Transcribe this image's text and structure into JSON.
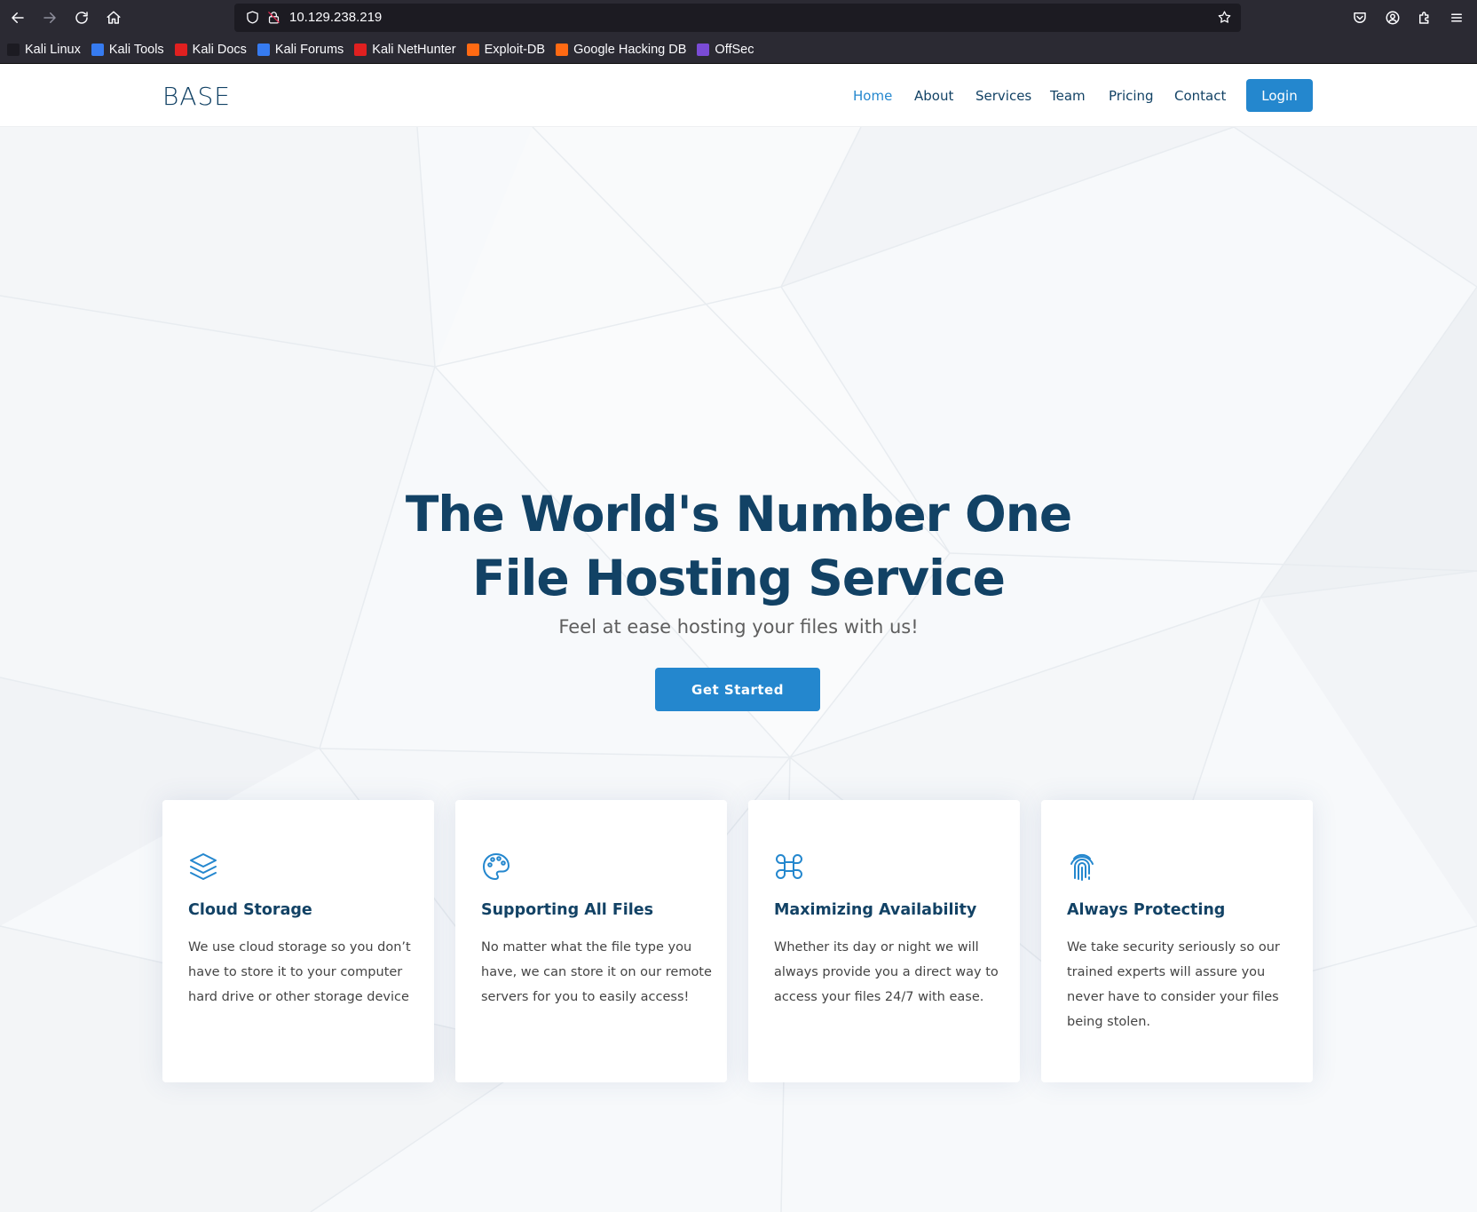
{
  "browser": {
    "url": "10.129.238.219",
    "bookmarks": [
      {
        "label": "Kali Linux",
        "color": "#1c1b22"
      },
      {
        "label": "Kali Tools",
        "color": "#367bf0"
      },
      {
        "label": "Kali Docs",
        "color": "#e02020"
      },
      {
        "label": "Kali Forums",
        "color": "#367bf0"
      },
      {
        "label": "Kali NetHunter",
        "color": "#e02020"
      },
      {
        "label": "Exploit-DB",
        "color": "#ff6a13"
      },
      {
        "label": "Google Hacking DB",
        "color": "#ff6a13"
      },
      {
        "label": "OffSec",
        "color": "#7a4bd6"
      }
    ]
  },
  "site": {
    "logo": "BASE",
    "nav": {
      "home": "Home",
      "about": "About",
      "services": "Services",
      "team": "Team",
      "pricing": "Pricing",
      "contact": "Contact",
      "login": "Login"
    },
    "hero": {
      "title_line1": "The World's Number One",
      "title_line2": "File Hosting Service",
      "subtitle": "Feel at ease hosting your files with us!",
      "cta": "Get Started"
    },
    "features": [
      {
        "icon": "layers-icon",
        "title": "Cloud Storage",
        "desc": "We use cloud storage so you don’t have to store it to your computer hard drive or other storage device"
      },
      {
        "icon": "palette-icon",
        "title": "Supporting All Files",
        "desc": "No matter what the file type you have, we can store it on our remote servers for you to easily access!"
      },
      {
        "icon": "command-icon",
        "title": "Maximizing Availability",
        "desc": "Whether its day or night we will always provide you a direct way to access your files 24/7 with ease."
      },
      {
        "icon": "fingerprint-icon",
        "title": "Always Protecting",
        "desc": "We take security seriously so our trained experts will assure you never have to consider your files being stolen."
      }
    ]
  },
  "colors": {
    "accent": "#2487ce",
    "heading": "#124265",
    "chrome_bg": "#2b2a33"
  }
}
